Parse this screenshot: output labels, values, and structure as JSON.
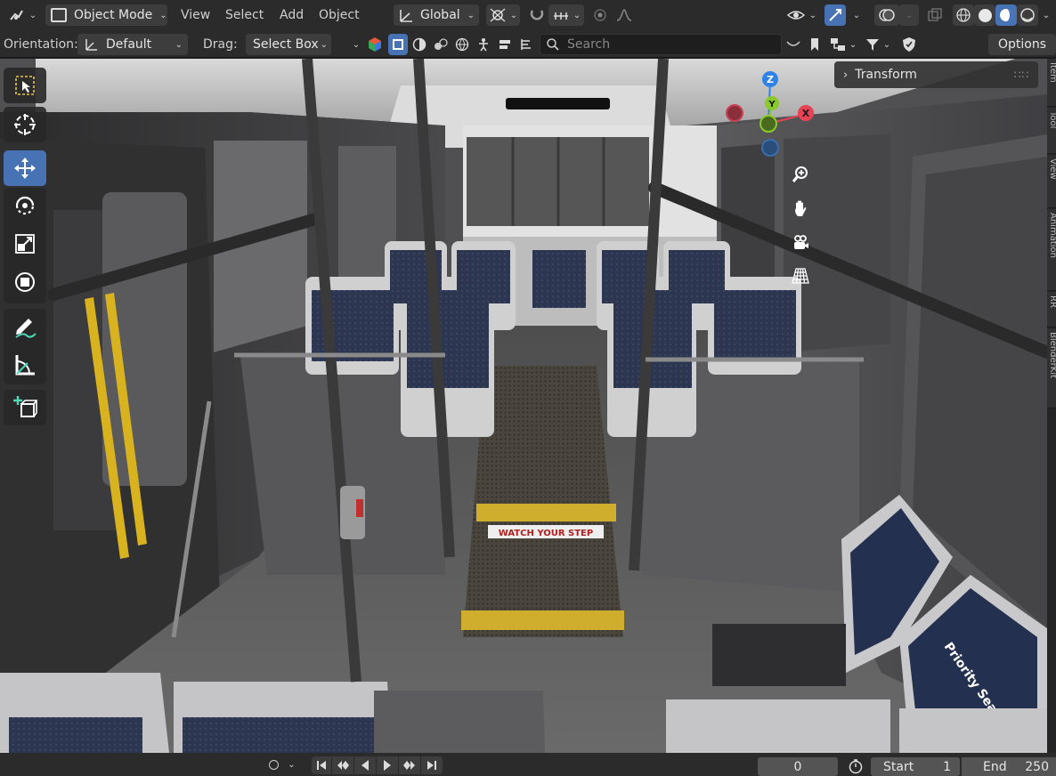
{
  "header": {
    "mode_label": "Object Mode",
    "menus": [
      "View",
      "Select",
      "Add",
      "Object"
    ],
    "transform_orientation": "Global"
  },
  "tool_header": {
    "orientation_label": "Orientation:",
    "orientation_value": "Default",
    "drag_label": "Drag:",
    "drag_value": "Select Box",
    "search_placeholder": "Search",
    "options_label": "Options"
  },
  "viewport": {
    "gizmo_axes": {
      "z": "Z",
      "y": "Y",
      "x": "X"
    },
    "sidebar_panel_title": "Transform",
    "sidebar_tabs": [
      "Item",
      "Tool",
      "View",
      "Animation",
      "RR",
      "BlenderKit"
    ],
    "scene_text": {
      "sign_watch_step": "WATCH YOUR STEP",
      "priority_seat": "Priority Seat"
    }
  },
  "timeline": {
    "current_frame": "0",
    "start_label": "Start",
    "start_value": "1",
    "end_label": "End",
    "end_value": "250"
  },
  "colors": {
    "accent": "#4772b3",
    "axis_x": "#e84255",
    "axis_y": "#8ac92b",
    "axis_z": "#2f83e6",
    "header_bg": "#2b2b2b"
  }
}
